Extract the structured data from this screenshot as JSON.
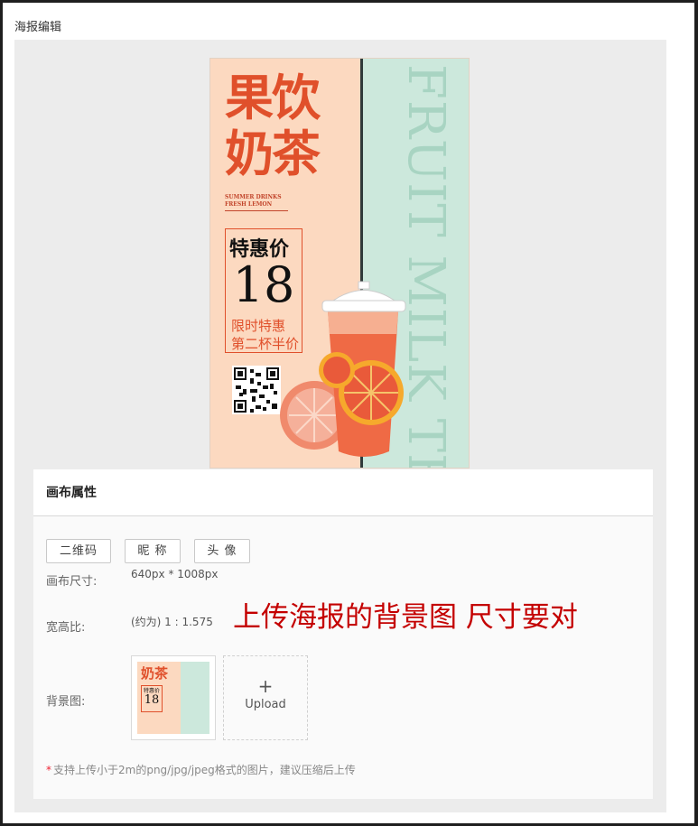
{
  "page": {
    "title": "海报编辑"
  },
  "poster": {
    "title": "果饮奶茶",
    "subtitle_line1": "SUMMER DRINKS",
    "subtitle_line2": "FRESH LEMON",
    "price_label": "特惠价",
    "price_value": "18",
    "promo_line1": "限时特惠",
    "promo_line2": "第二杯半价",
    "vertical_text": "FRUIT MILK TEA",
    "colors": {
      "peach": "#fcd9c0",
      "mint": "#cce8dc",
      "accent": "#e0502b"
    }
  },
  "panel": {
    "title": "画布属性",
    "buttons": [
      "二维码",
      "昵 称",
      "头 像"
    ],
    "canvas_size_label": "画布尺寸:",
    "canvas_size_value": "640px * 1008px",
    "ratio_label": "宽高比:",
    "ratio_value": "(约为) 1 : 1.575",
    "annotation": "上传海报的背景图  尺寸要对",
    "background_label": "背景图:",
    "thumb": {
      "title": "奶茶",
      "price_label": "特惠价",
      "price": "18"
    },
    "upload_icon": "plus-icon",
    "upload_label": "Upload",
    "hint_star": "*",
    "hint": "支持上传小于2m的png/jpg/jpeg格式的图片，建议压缩后上传"
  }
}
